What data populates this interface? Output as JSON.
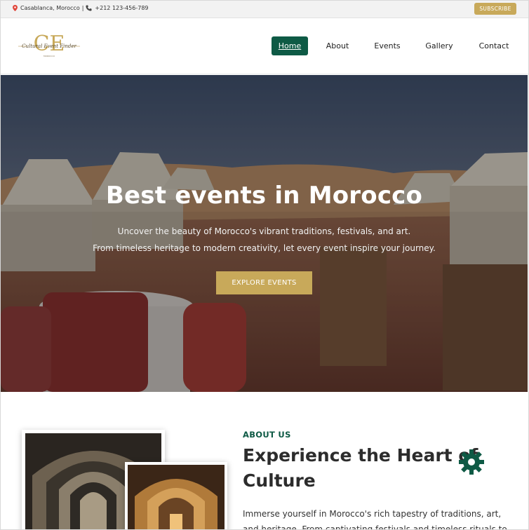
{
  "topbar": {
    "location": "Casablanca, Morocco",
    "phone": "+212 123-456-789",
    "subscribe_label": "SUBSCRIBE"
  },
  "logo": {
    "monogram": "CE",
    "name": "Cultural Event Finder",
    "tagline": "MOROCCO"
  },
  "nav": {
    "items": [
      {
        "label": "Home",
        "active": true
      },
      {
        "label": "About"
      },
      {
        "label": "Events"
      },
      {
        "label": "Gallery"
      },
      {
        "label": "Contact"
      }
    ]
  },
  "hero": {
    "title": "Best events in Morocco",
    "subtitle_line1": "Uncover the beauty of Morocco's vibrant traditions, festivals, and art.",
    "subtitle_line2": "From timeless heritage to modern creativity, let every event inspire your journey.",
    "button_label": "EXPLORE EVENTS"
  },
  "about": {
    "label": "ABOUT US",
    "heading_line1": "Experience the Heart of",
    "heading_line2": "Culture",
    "paragraph": "Immerse yourself in Morocco's rich tapestry of traditions, art, and heritage. From captivating festivals and timeless rituals to"
  },
  "colors": {
    "brand_green": "#0e5a45",
    "gold": "#c8a95a"
  },
  "icons": [
    "location-pin-icon",
    "phone-icon",
    "gear-icon"
  ]
}
